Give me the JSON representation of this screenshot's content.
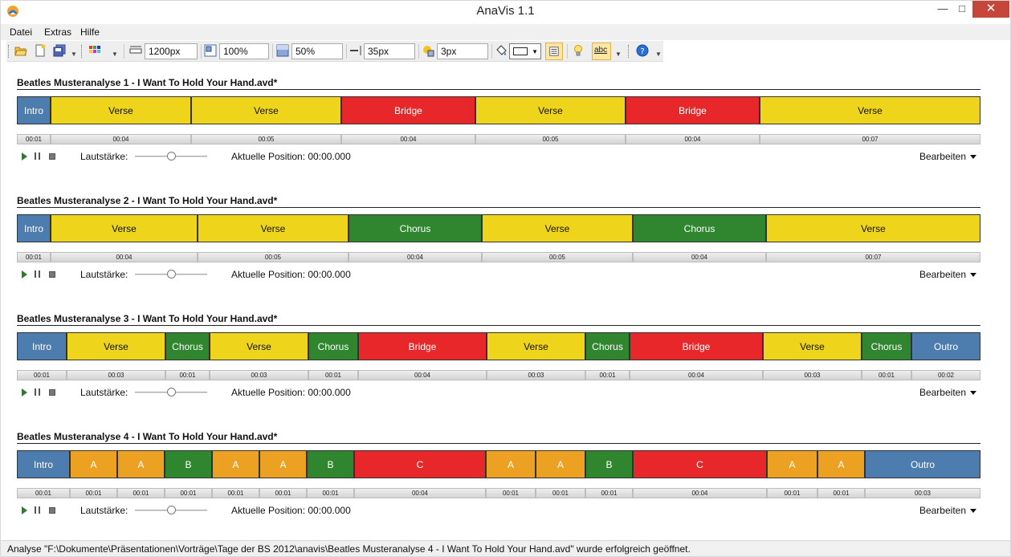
{
  "app": {
    "title": "AnaVis 1.1"
  },
  "menu": {
    "items": [
      "Datei",
      "Extras",
      "Hilfe"
    ]
  },
  "toolbar": {
    "width_value": "1200px",
    "zoom_value": "100%",
    "opacity_value": "50%",
    "height_value": "35px",
    "border_value": "3px",
    "text_toggle_label": "abc"
  },
  "labels": {
    "volume": "Lautstärke:",
    "position": "Aktuelle Position: 00:00.000",
    "edit": "Bearbeiten"
  },
  "colors": {
    "Intro": "#4d7cae",
    "Outro": "#4d7cae",
    "Verse": "#eed51c",
    "Bridge": "#e8272a",
    "Chorus": "#2f862f",
    "A": "#eca123",
    "B": "#2f862f",
    "C": "#e8272a"
  },
  "analyses": [
    {
      "title": "Beatles Musteranalyse 1 - I Want To Hold Your Hand.avd*",
      "segments": [
        {
          "label": "Intro",
          "duration": "00:01",
          "seconds": 1
        },
        {
          "label": "Verse",
          "duration": "00:04",
          "seconds": 4.2
        },
        {
          "label": "Verse",
          "duration": "00:05",
          "seconds": 4.5
        },
        {
          "label": "Bridge",
          "duration": "00:04",
          "seconds": 4
        },
        {
          "label": "Verse",
          "duration": "00:05",
          "seconds": 4.5
        },
        {
          "label": "Bridge",
          "duration": "00:04",
          "seconds": 4
        },
        {
          "label": "Verse",
          "duration": "00:07",
          "seconds": 6.6
        }
      ]
    },
    {
      "title": "Beatles Musteranalyse 2 - I Want To Hold Your Hand.avd*",
      "segments": [
        {
          "label": "Intro",
          "duration": "00:01",
          "seconds": 1
        },
        {
          "label": "Verse",
          "duration": "00:04",
          "seconds": 4.4
        },
        {
          "label": "Verse",
          "duration": "00:05",
          "seconds": 4.5
        },
        {
          "label": "Chorus",
          "duration": "00:04",
          "seconds": 4
        },
        {
          "label": "Verse",
          "duration": "00:05",
          "seconds": 4.5
        },
        {
          "label": "Chorus",
          "duration": "00:04",
          "seconds": 4
        },
        {
          "label": "Verse",
          "duration": "00:07",
          "seconds": 6.4
        }
      ]
    },
    {
      "title": "Beatles Musteranalyse 3 - I Want To Hold Your Hand.avd*",
      "segments": [
        {
          "label": "Intro",
          "duration": "00:01",
          "seconds": 1
        },
        {
          "label": "Verse",
          "duration": "00:03",
          "seconds": 2
        },
        {
          "label": "Chorus",
          "duration": "00:01",
          "seconds": 0.9
        },
        {
          "label": "Verse",
          "duration": "00:03",
          "seconds": 2
        },
        {
          "label": "Chorus",
          "duration": "00:01",
          "seconds": 1
        },
        {
          "label": "Bridge",
          "duration": "00:04",
          "seconds": 2.6
        },
        {
          "label": "Verse",
          "duration": "00:03",
          "seconds": 2
        },
        {
          "label": "Chorus",
          "duration": "00:01",
          "seconds": 0.9
        },
        {
          "label": "Bridge",
          "duration": "00:04",
          "seconds": 2.7
        },
        {
          "label": "Verse",
          "duration": "00:03",
          "seconds": 2
        },
        {
          "label": "Chorus",
          "duration": "00:01",
          "seconds": 1
        },
        {
          "label": "Outro",
          "duration": "00:02",
          "seconds": 1.4
        }
      ]
    },
    {
      "title": "Beatles Musteranalyse 4 - I Want To Hold Your Hand.avd*",
      "segments": [
        {
          "label": "Intro",
          "duration": "00:01",
          "seconds": 1
        },
        {
          "label": "A",
          "duration": "00:01",
          "seconds": 0.9
        },
        {
          "label": "A",
          "duration": "00:01",
          "seconds": 0.9
        },
        {
          "label": "B",
          "duration": "00:01",
          "seconds": 0.9
        },
        {
          "label": "A",
          "duration": "00:01",
          "seconds": 0.9
        },
        {
          "label": "A",
          "duration": "00:01",
          "seconds": 0.9
        },
        {
          "label": "B",
          "duration": "00:01",
          "seconds": 0.9
        },
        {
          "label": "C",
          "duration": "00:04",
          "seconds": 2.5
        },
        {
          "label": "A",
          "duration": "00:01",
          "seconds": 0.95
        },
        {
          "label": "A",
          "duration": "00:01",
          "seconds": 0.95
        },
        {
          "label": "B",
          "duration": "00:01",
          "seconds": 0.9
        },
        {
          "label": "C",
          "duration": "00:04",
          "seconds": 2.55
        },
        {
          "label": "A",
          "duration": "00:01",
          "seconds": 0.95
        },
        {
          "label": "A",
          "duration": "00:01",
          "seconds": 0.9
        },
        {
          "label": "Outro",
          "duration": "00:03",
          "seconds": 2.2
        }
      ]
    }
  ],
  "status": {
    "text": "Analyse \"F:\\Dokumente\\Präsentationen\\Vorträge\\Tage der BS 2012\\anavis\\Beatles Musteranalyse 4 - I Want To Hold Your Hand.avd\" wurde erfolgreich geöffnet."
  }
}
